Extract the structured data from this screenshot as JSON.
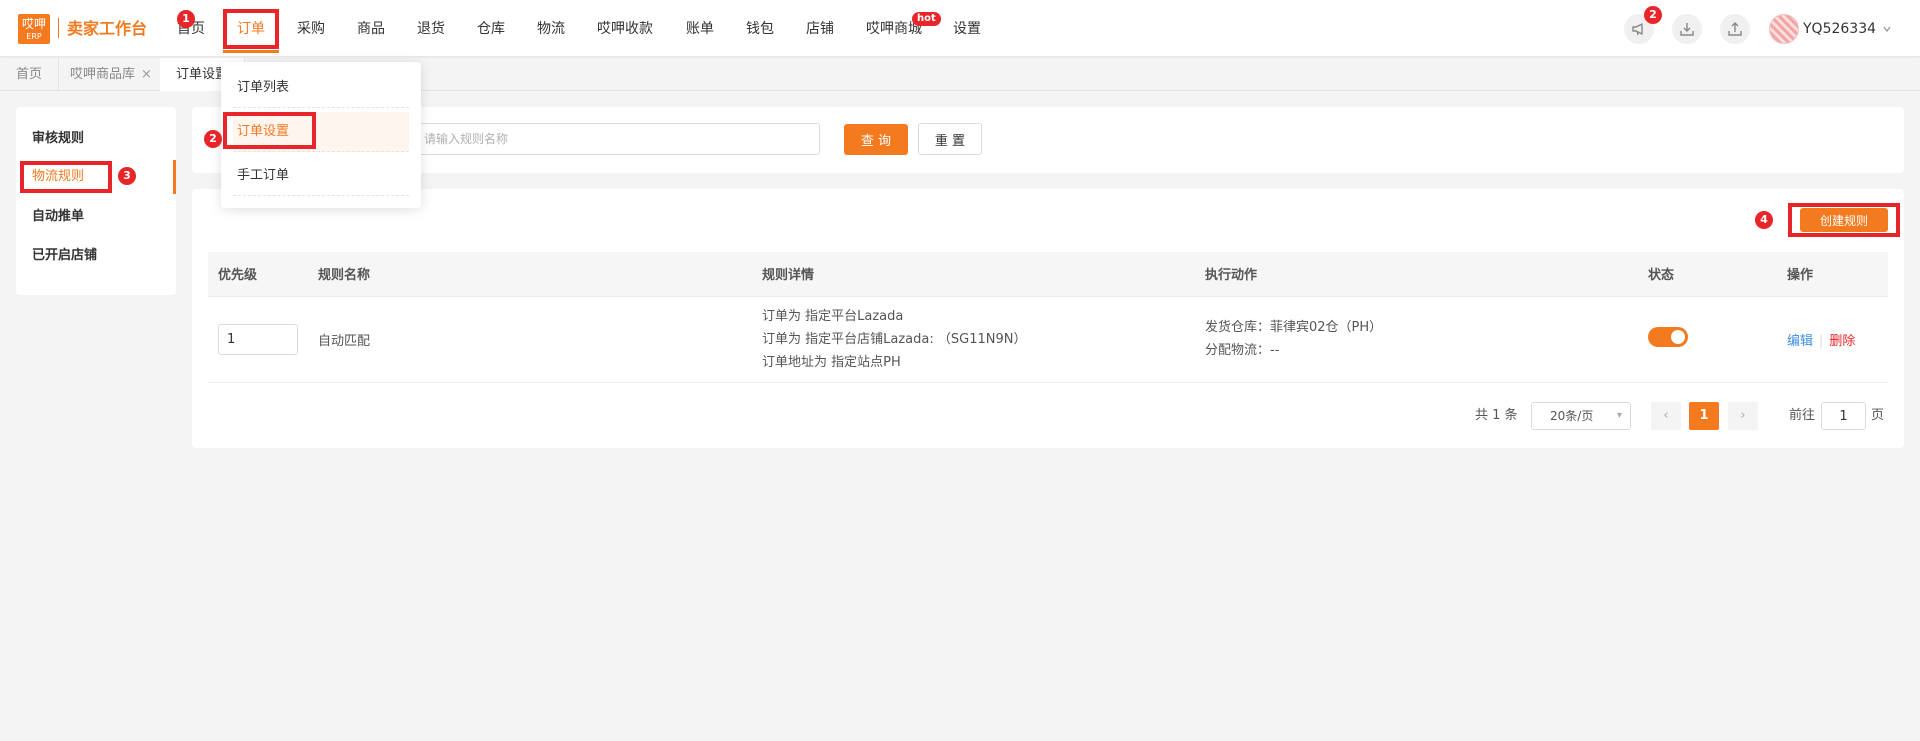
{
  "header": {
    "logo_top": "哎呷",
    "logo_bottom": "ERP",
    "brand": "卖家工作台",
    "nav": [
      "首页",
      "订单",
      "采购",
      "商品",
      "退货",
      "仓库",
      "物流",
      "哎呷收款",
      "账单",
      "钱包",
      "店铺",
      "哎呷商城",
      "设置"
    ],
    "active_nav": "订单",
    "hot_badge": "hot",
    "notification_count": "2",
    "username": "YQ526334",
    "icons": [
      "megaphone-icon",
      "download-icon",
      "upload-icon",
      "avatar",
      "chevron-down-icon"
    ]
  },
  "steps": [
    "1",
    "2",
    "3",
    "4"
  ],
  "tabs": [
    "首页",
    "哎呷商品库",
    "订单设置"
  ],
  "tab_close": "×",
  "dropdown": {
    "items": [
      "订单列表",
      "订单设置",
      "手工订单"
    ],
    "active": "订单设置"
  },
  "sidebar": {
    "items": [
      "审核规则",
      "物流规则",
      "自动推单",
      "已开启店铺"
    ],
    "active": "物流规则"
  },
  "search": {
    "placeholder": "请输入规则名称",
    "query_label": "查 询",
    "reset_label": "重 置"
  },
  "create_button": "创建规则",
  "table": {
    "columns": [
      "优先级",
      "规则名称",
      "规则详情",
      "执行动作",
      "状态",
      "操作"
    ],
    "rows": [
      {
        "priority": "1",
        "name": "自动匹配",
        "details": [
          "订单为 指定平台Lazada",
          "订单为 指定平台店铺Lazada: （SG11N9N）",
          "订单地址为 指定站点PH"
        ],
        "actions": [
          "发货仓库：菲律宾02仓（PH）",
          "分配物流：--"
        ],
        "enabled": true,
        "edit": "编辑",
        "delete": "删除"
      }
    ]
  },
  "pagination": {
    "total": "共 1 条",
    "page_size": "20条/页",
    "prev": "‹",
    "current": "1",
    "next": "›",
    "goto": "前往",
    "goto_value": "1",
    "page": "页"
  },
  "colors": {
    "accent": "#f47a20",
    "highlight": "#e8262a",
    "link": "#3a8ee6"
  }
}
